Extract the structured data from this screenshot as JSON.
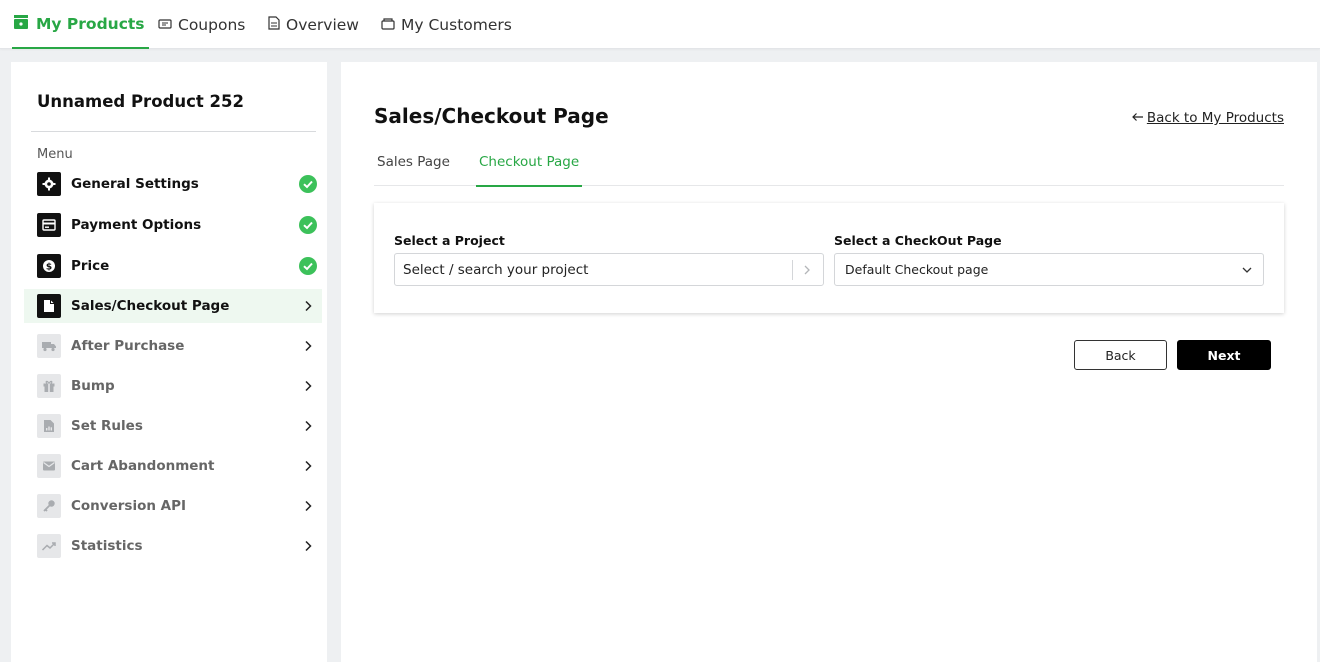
{
  "topnav": {
    "tabs": [
      {
        "label": "My Products",
        "icon": "store-icon",
        "active": true
      },
      {
        "label": "Coupons",
        "icon": "ticket-icon",
        "active": false
      },
      {
        "label": "Overview",
        "icon": "document-icon",
        "active": false
      },
      {
        "label": "My Customers",
        "icon": "customers-icon",
        "active": false
      }
    ]
  },
  "sidebar": {
    "product_title": "Unnamed Product 252",
    "menu_label": "Menu",
    "items": [
      {
        "label": "General Settings",
        "icon": "gear-icon",
        "status": "complete"
      },
      {
        "label": "Payment Options",
        "icon": "card-icon",
        "status": "complete"
      },
      {
        "label": "Price",
        "icon": "dollar-icon",
        "status": "complete"
      },
      {
        "label": "Sales/Checkout Page",
        "icon": "page-icon",
        "status": "current"
      },
      {
        "label": "After Purchase",
        "icon": "truck-icon",
        "status": "pending"
      },
      {
        "label": "Bump",
        "icon": "gift-icon",
        "status": "pending"
      },
      {
        "label": "Set Rules",
        "icon": "report-icon",
        "status": "pending"
      },
      {
        "label": "Cart Abandonment",
        "icon": "mail-icon",
        "status": "pending"
      },
      {
        "label": "Conversion API",
        "icon": "key-icon",
        "status": "pending"
      },
      {
        "label": "Statistics",
        "icon": "trend-icon",
        "status": "pending"
      }
    ]
  },
  "main": {
    "title": "Sales/Checkout Page",
    "back_link": "Back to My Products",
    "subtabs": [
      {
        "label": "Sales Page",
        "active": false
      },
      {
        "label": "Checkout Page",
        "active": true
      }
    ],
    "project_field": {
      "label": "Select a Project",
      "value": "Select / search your project"
    },
    "checkout_field": {
      "label": "Select a CheckOut Page",
      "value": "Default Checkout page"
    },
    "buttons": {
      "back": "Back",
      "next": "Next"
    }
  },
  "colors": {
    "accent": "#28a745",
    "check": "#3cc15a",
    "active_bg": "#eef8f0"
  }
}
